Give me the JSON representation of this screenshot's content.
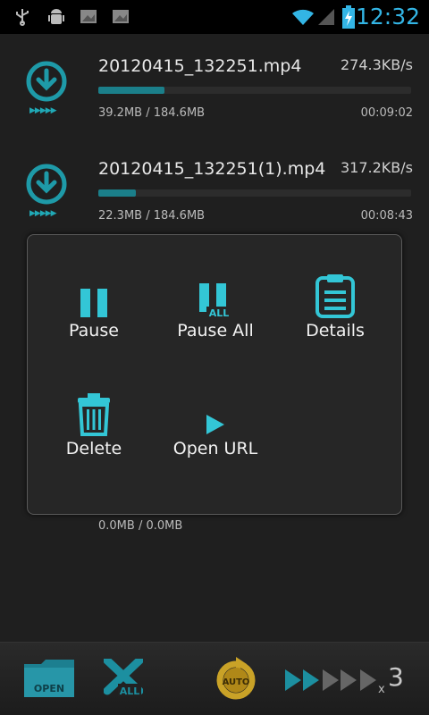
{
  "status_bar": {
    "time": "12:32",
    "icons": [
      "usb-icon",
      "android-debug-icon",
      "screenshot-icon",
      "screenshot-icon",
      "wifi-icon",
      "signal-icon",
      "battery-charging-icon"
    ]
  },
  "downloads": [
    {
      "name": "20120415_132251.mp4",
      "speed": "274.3KB/s",
      "size": "39.2MB / 184.6MB",
      "remaining": "00:09:02",
      "progress": 0.21
    },
    {
      "name": "20120415_132251(1).mp4",
      "speed": "317.2KB/s",
      "size": "22.3MB / 184.6MB",
      "remaining": "00:08:43",
      "progress": 0.12
    },
    {
      "size": "0.0MB / 0.0MB"
    }
  ],
  "popup_menu": {
    "items": [
      {
        "label": "Pause",
        "icon": "pause-icon"
      },
      {
        "label": "Pause All",
        "icon": "pause-all-icon",
        "badge": "ALL"
      },
      {
        "label": "Details",
        "icon": "clipboard-icon"
      },
      {
        "label": "Delete",
        "icon": "trash-icon"
      },
      {
        "label": "Open URL",
        "icon": "play-icon"
      }
    ]
  },
  "bottom_bar": {
    "open_label": "OPEN",
    "delete_all_label": "ALL",
    "auto_label": "AUTO",
    "speed_multiplier": "x3"
  },
  "colors": {
    "accent": "#33c6d6",
    "progress": "#1b7f8a",
    "auto": "#c9a227"
  }
}
